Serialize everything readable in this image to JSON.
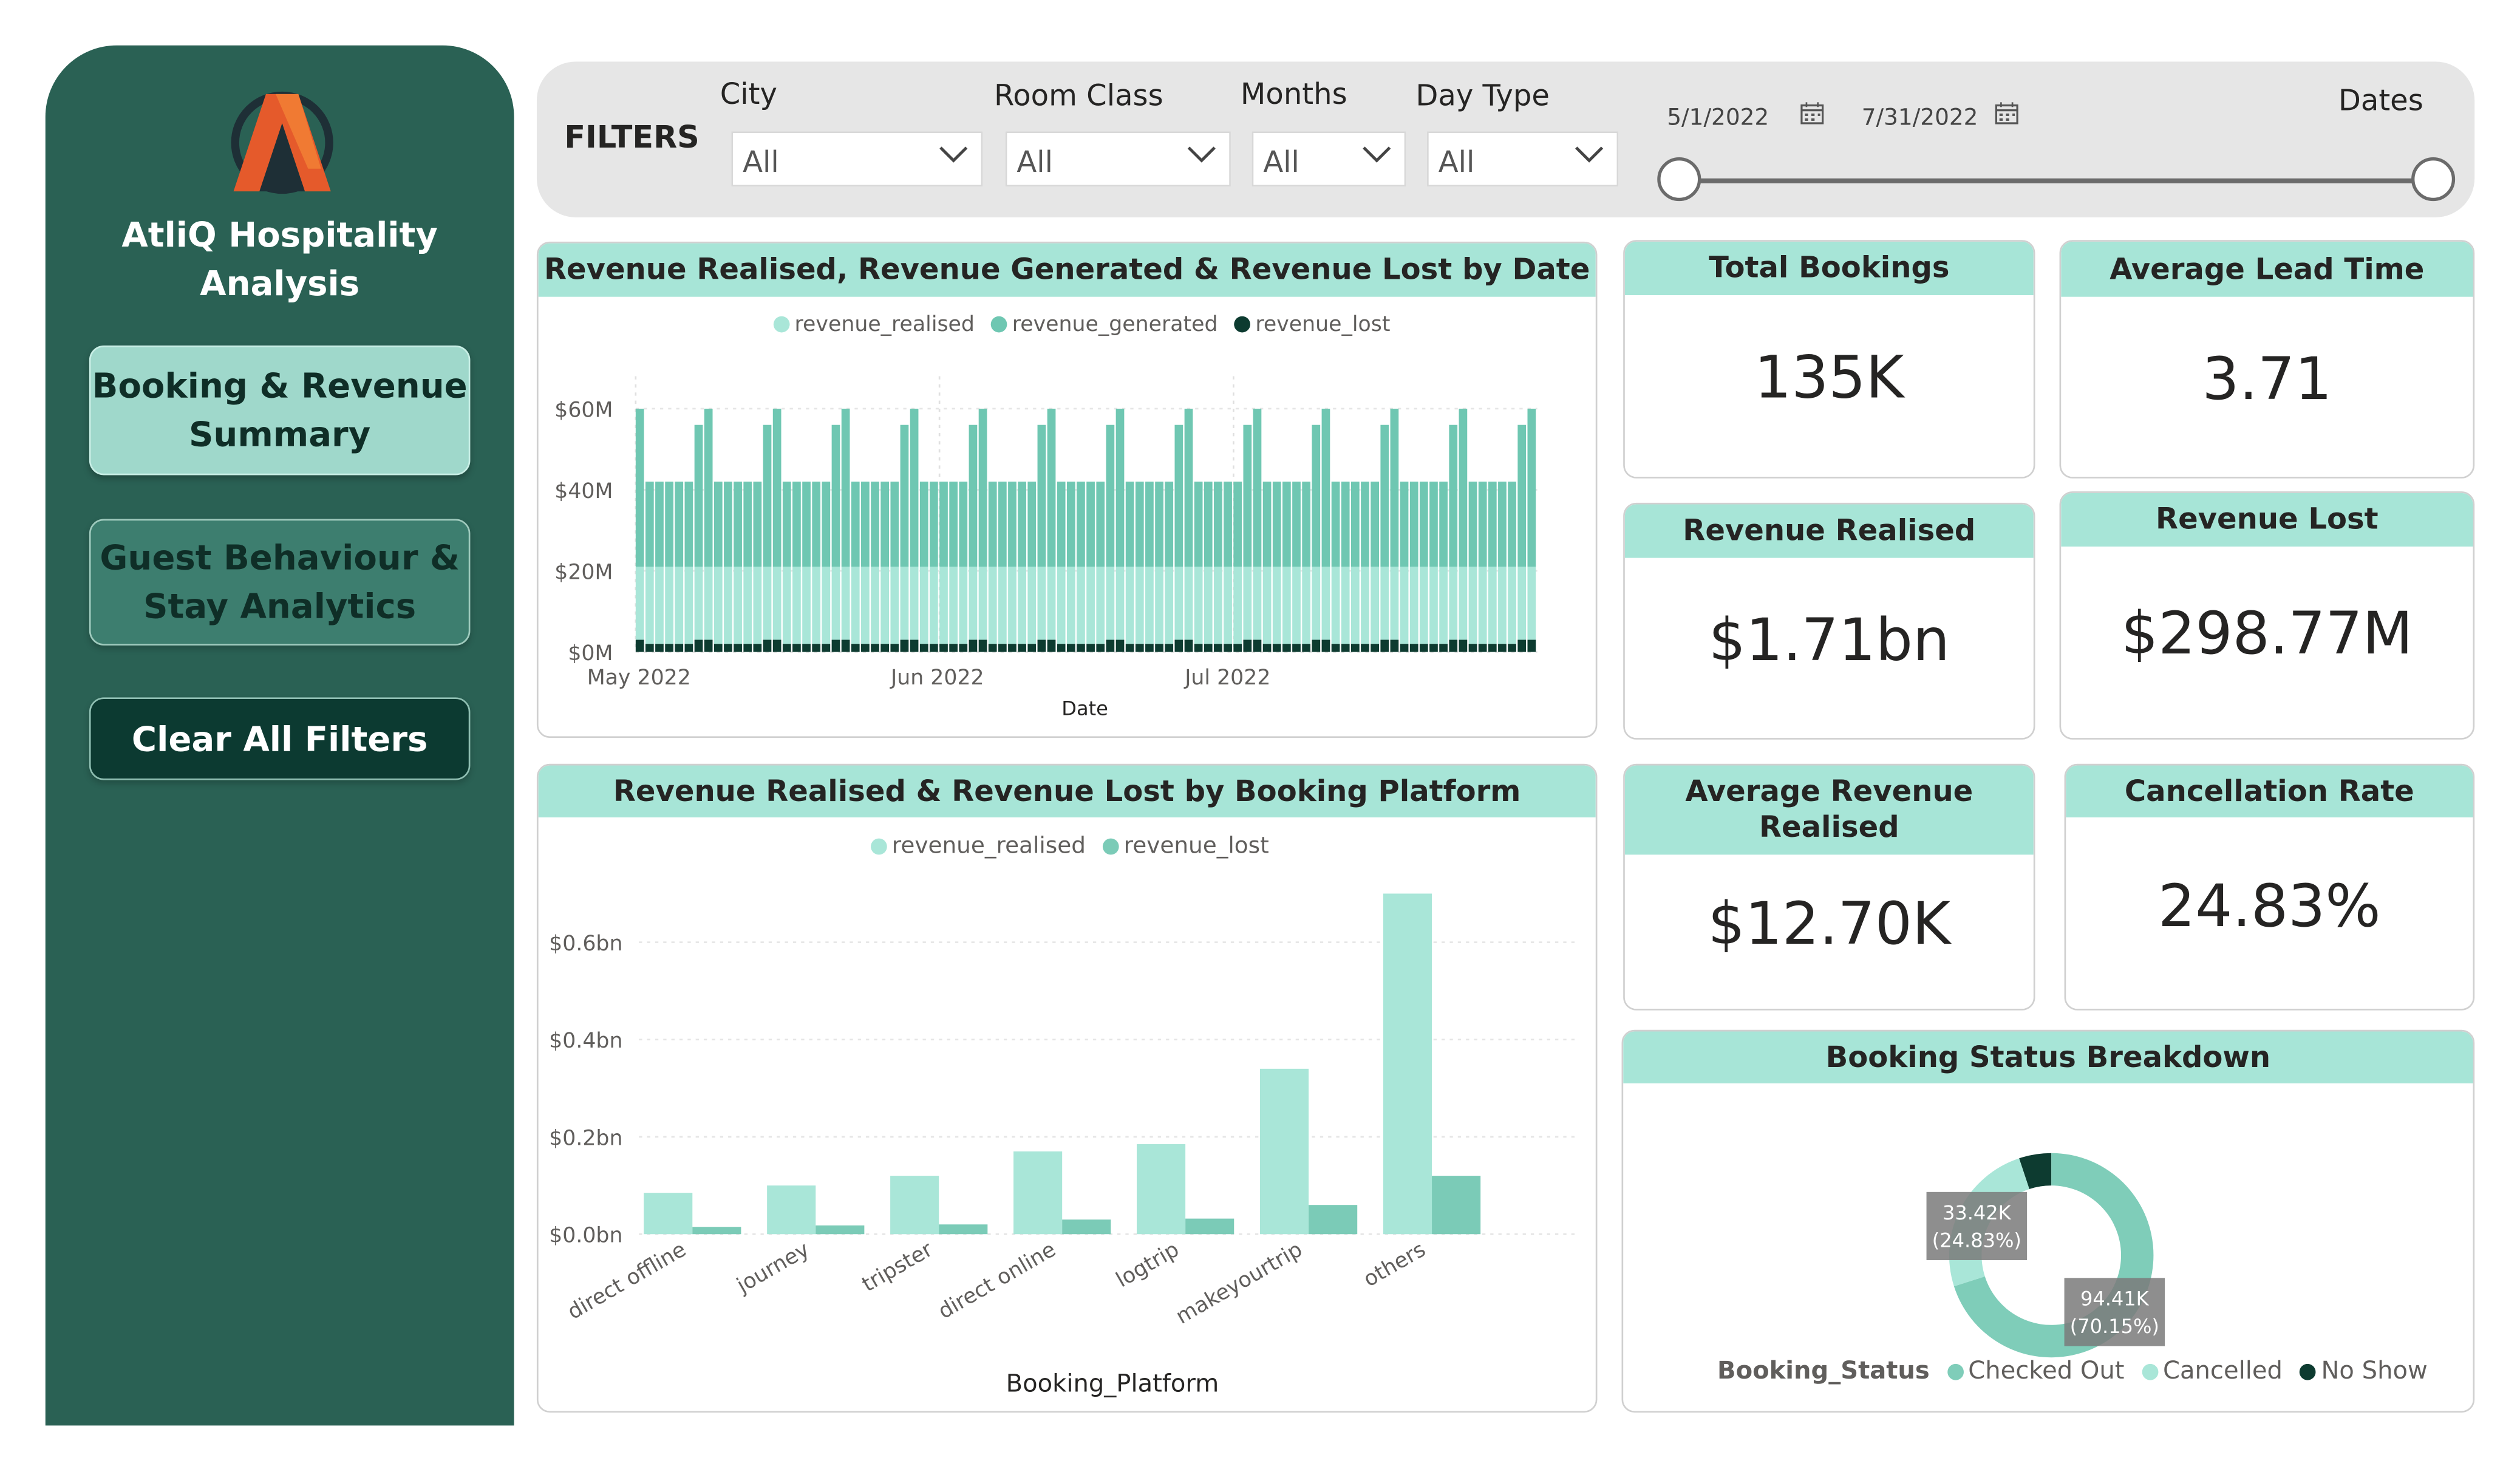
{
  "sidebar": {
    "app_title_line1": "AtliQ Hospitality",
    "app_title_line2": "Analysis",
    "nav": [
      {
        "line1": "Booking & Revenue",
        "line2": "Summary"
      },
      {
        "line1": "Guest Behaviour &",
        "line2": "Stay Analytics"
      }
    ],
    "clear_filters": "Clear All Filters"
  },
  "filters": {
    "title": "FILTERS",
    "city": {
      "label": "City",
      "value": "All"
    },
    "room_class": {
      "label": "Room Class",
      "value": "All"
    },
    "months": {
      "label": "Months",
      "value": "All"
    },
    "day_type": {
      "label": "Day Type",
      "value": "All"
    },
    "dates": {
      "label": "Dates",
      "start": "5/1/2022",
      "end": "7/31/2022"
    }
  },
  "kpis": {
    "total_bookings": {
      "label": "Total Bookings",
      "value": "135K"
    },
    "avg_lead_time": {
      "label": "Average Lead Time",
      "value": "3.71"
    },
    "revenue_realised": {
      "label": "Revenue Realised",
      "value": "$1.71bn"
    },
    "revenue_lost": {
      "label": "Revenue Lost",
      "value": "$298.77M"
    },
    "avg_revenue_realised": {
      "label_line1": "Average Revenue",
      "label_line2": "Realised",
      "value": "$12.70K"
    },
    "cancellation_rate": {
      "label": "Cancellation Rate",
      "value": "24.83%"
    }
  },
  "colors": {
    "sidebar_bg": "#2a6154",
    "header_teal": "#a7e5d7",
    "revenue_realised": "#a9e6d8",
    "revenue_generated": "#6fc7b2",
    "revenue_lost": "#0d3b30",
    "platform_lost": "#7bcbb7"
  },
  "chart_data": [
    {
      "type": "area",
      "title": "Revenue Realised, Revenue Generated & Revenue Lost by Date",
      "xlabel": "Date",
      "ylabel": "",
      "y_ticks": [
        "$0M",
        "$20M",
        "$40M",
        "$60M"
      ],
      "x_ticks": [
        "May 2022",
        "Jun 2022",
        "Jul 2022"
      ],
      "ylim": [
        0,
        66
      ],
      "legend_position": "top-center",
      "series": [
        {
          "name": "revenue_realised",
          "description_values_in_millions_daily": [
            "May 1..Jul 31 repeating weekly: weekend peaks ~60, weekdays ~42 (generated); realised ~21 weekdays, ~21 weekends; lost ~2-3"
          ]
        },
        {
          "name": "revenue_generated",
          "values": []
        },
        {
          "name": "revenue_lost",
          "values": []
        }
      ],
      "weekly_pattern": {
        "generated": [
          60,
          42,
          42,
          42,
          42,
          42,
          56
        ],
        "realised": [
          21,
          21,
          21,
          21,
          21,
          21,
          21
        ],
        "lost": [
          3,
          2,
          2,
          2,
          2,
          2,
          3
        ]
      },
      "days": 92
    },
    {
      "type": "bar",
      "title": "Revenue Realised & Revenue Lost by Booking Platform",
      "xlabel": "Booking_Platform",
      "ylabel": "",
      "y_ticks": [
        "$0.0bn",
        "$0.2bn",
        "$0.4bn",
        "$0.6bn"
      ],
      "ylim": [
        0,
        0.7
      ],
      "legend_position": "top-center",
      "categories": [
        "direct offline",
        "journey",
        "tripster",
        "direct online",
        "logtrip",
        "makeyourtrip",
        "others"
      ],
      "series": [
        {
          "name": "revenue_realised",
          "values": [
            0.085,
            0.1,
            0.12,
            0.17,
            0.185,
            0.34,
            0.7
          ]
        },
        {
          "name": "revenue_lost",
          "values": [
            0.015,
            0.018,
            0.02,
            0.03,
            0.032,
            0.06,
            0.12
          ]
        }
      ]
    },
    {
      "type": "pie",
      "title": "Booking Status Breakdown",
      "legend_title": "Booking_Status",
      "categories": [
        "Checked Out",
        "Cancelled",
        "No Show"
      ],
      "values": [
        94.41,
        33.42,
        6.88
      ],
      "labels": [
        {
          "value": "94.41K",
          "pct": "(70.15%)"
        },
        {
          "value": "33.42K",
          "pct": "(24.83%)"
        }
      ],
      "colors": [
        "#7fcdb9",
        "#a9e6d8",
        "#0d3b30"
      ]
    }
  ]
}
